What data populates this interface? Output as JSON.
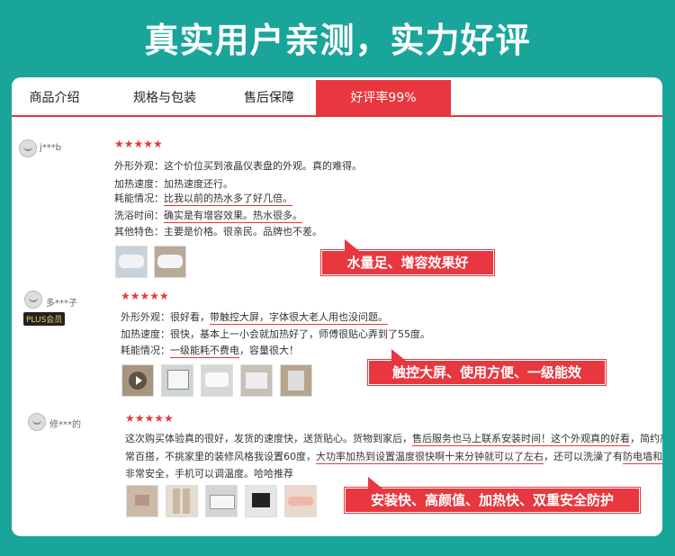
{
  "headline": "真实用户亲测，实力好评",
  "tabs": [
    {
      "label": "商品介绍"
    },
    {
      "label": "规格与包装"
    },
    {
      "label": "售后保障"
    },
    {
      "label": "好评率99%"
    }
  ],
  "colors": {
    "accent": "#e8373e",
    "background": "#1aa59b"
  },
  "reviews": [
    {
      "user": "j***b",
      "stars": "★★★★★",
      "lines": [
        {
          "label": "外形外观：",
          "text": "这个价位买到液晶仪表盘的外观。真的难得。"
        },
        {
          "label": "加热速度：",
          "text": "加热速度还行。"
        },
        {
          "label": "耗能情况：",
          "text": "比我以前的热水多了好几倍。"
        },
        {
          "label": "洗浴时间：",
          "text": "确实是有增容效果。热水很多。"
        },
        {
          "label": "其他特色：",
          "text": "主要是价格。很亲民。品牌也不差。"
        }
      ],
      "callout": "水量足、增容效果好"
    },
    {
      "user": "多***子",
      "badge": "PLUS会员",
      "stars": "★★★★★",
      "lines": [
        {
          "label": "外形外观：",
          "pre": "很好看，",
          "text": "带触控大屏，字体很大老人用也没问题。"
        },
        {
          "label": "加热速度：",
          "text": "很快，基本上一小会就加热好了，师傅很贴心弄到了55度。"
        },
        {
          "label": "耗能情况：",
          "text": "一级能耗不费电",
          "post": "，容量很大！"
        }
      ],
      "callout": "触控大屏、使用方便、一级能效"
    },
    {
      "user": "修***的",
      "stars": "★★★★★",
      "p1a": "这次购买体验真的很好，发货的速度快，送货贴心。货物到家后，",
      "p1b": "售后服务也马上联系安装时间！",
      "p1c": "这个外观真的好看",
      "p1d": "，简约高级非",
      "p2a": "常百搭，不挑家里的装修风格我设置60度，",
      "p2b": "大功率加热到设置温度很快啊十来分钟就可以了左右",
      "p2c": "，还可以洗澡了有",
      "p2d": "防电墙和防电闸",
      "p3": "非常安全，手机可以调温度。哈哈推荐",
      "callout": "安装快、高颜值、加热快、双重安全防护"
    }
  ]
}
